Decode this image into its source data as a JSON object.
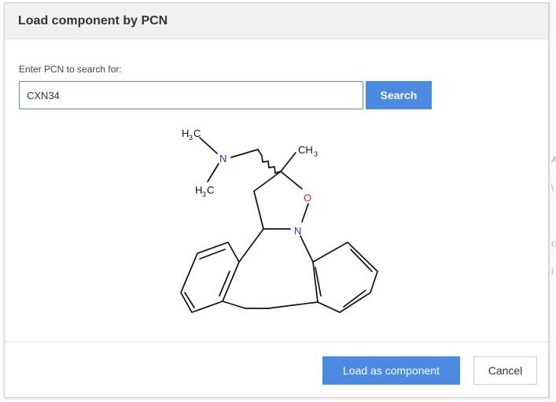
{
  "dialog": {
    "title": "Load component by PCN",
    "prompt_label": "Enter PCN to search for:",
    "search_value": "CXN34",
    "search_button_label": "Search",
    "load_button_label": "Load as component",
    "cancel_button_label": "Cancel"
  },
  "structure": {
    "labels": {
      "n_amine": "N",
      "n_ring": "N",
      "oxygen": "O",
      "h3c_top_h": "H",
      "h3c_top_3": "3",
      "h3c_top_c": "C",
      "h3c_bottom_h": "H",
      "h3c_bottom_3": "3",
      "h3c_bottom_c": "C",
      "ch3_c": "CH",
      "ch3_3": "3"
    },
    "colors": {
      "nitrogen": "#2f2fb5",
      "oxygen": "#e02020",
      "bond": "#111111"
    }
  },
  "theme": {
    "accent": "#4a8ae0",
    "header_bg": "#f1f1f1"
  }
}
